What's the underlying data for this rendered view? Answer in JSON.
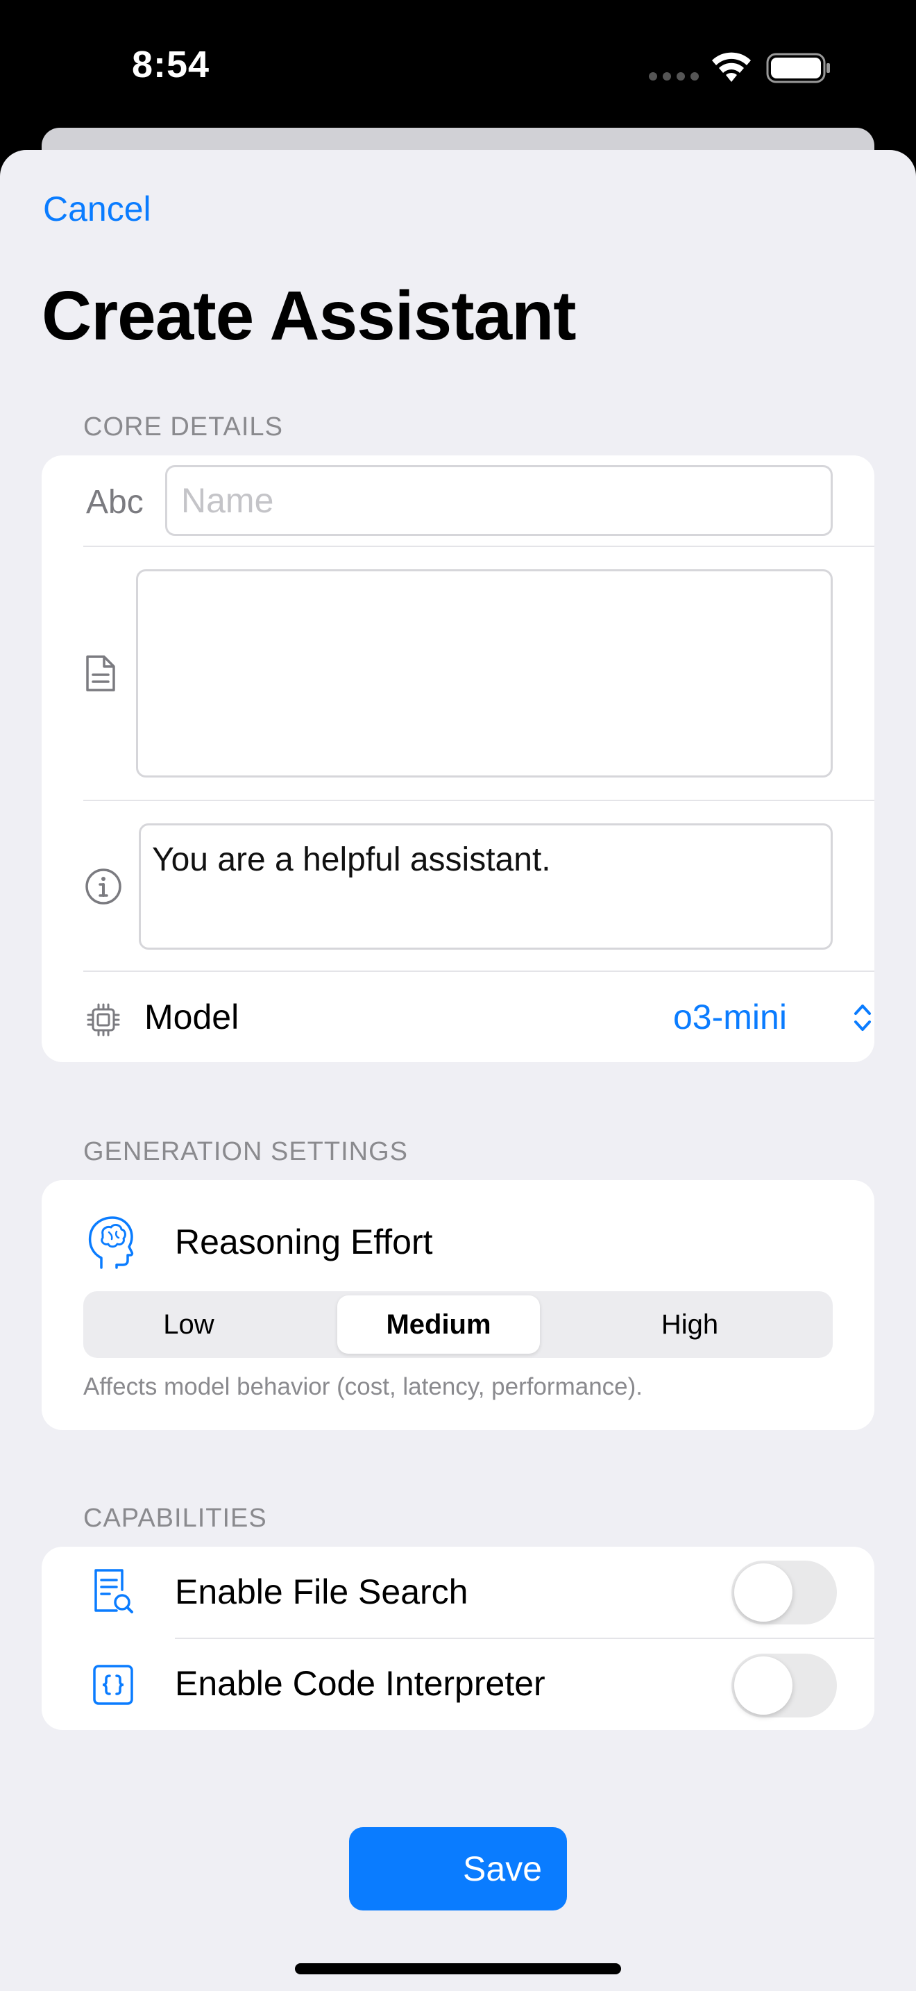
{
  "status_bar": {
    "time": "8:54"
  },
  "nav": {
    "cancel_label": "Cancel"
  },
  "page": {
    "title": "Create Assistant"
  },
  "core_details": {
    "header": "CORE DETAILS",
    "name_icon_text": "Abc",
    "name_placeholder": "Name",
    "name_value": "",
    "description_value": "",
    "instructions_value": "You are a helpful assistant.",
    "model_label": "Model",
    "model_value": "o3-mini"
  },
  "generation_settings": {
    "header": "GENERATION SETTINGS",
    "reasoning_label": "Reasoning Effort",
    "segments": [
      "Low",
      "Medium",
      "High"
    ],
    "selected": "Medium",
    "caption": "Affects model behavior (cost, latency, performance)."
  },
  "capabilities": {
    "header": "CAPABILITIES",
    "file_search_label": "Enable File Search",
    "file_search_enabled": false,
    "code_interpreter_label": "Enable Code Interpreter",
    "code_interpreter_enabled": false
  },
  "actions": {
    "save_label": "Save"
  },
  "colors": {
    "accent": "#0a7cff",
    "background": "#efeff4",
    "card": "#ffffff",
    "secondary_text": "#8a8a8e"
  }
}
